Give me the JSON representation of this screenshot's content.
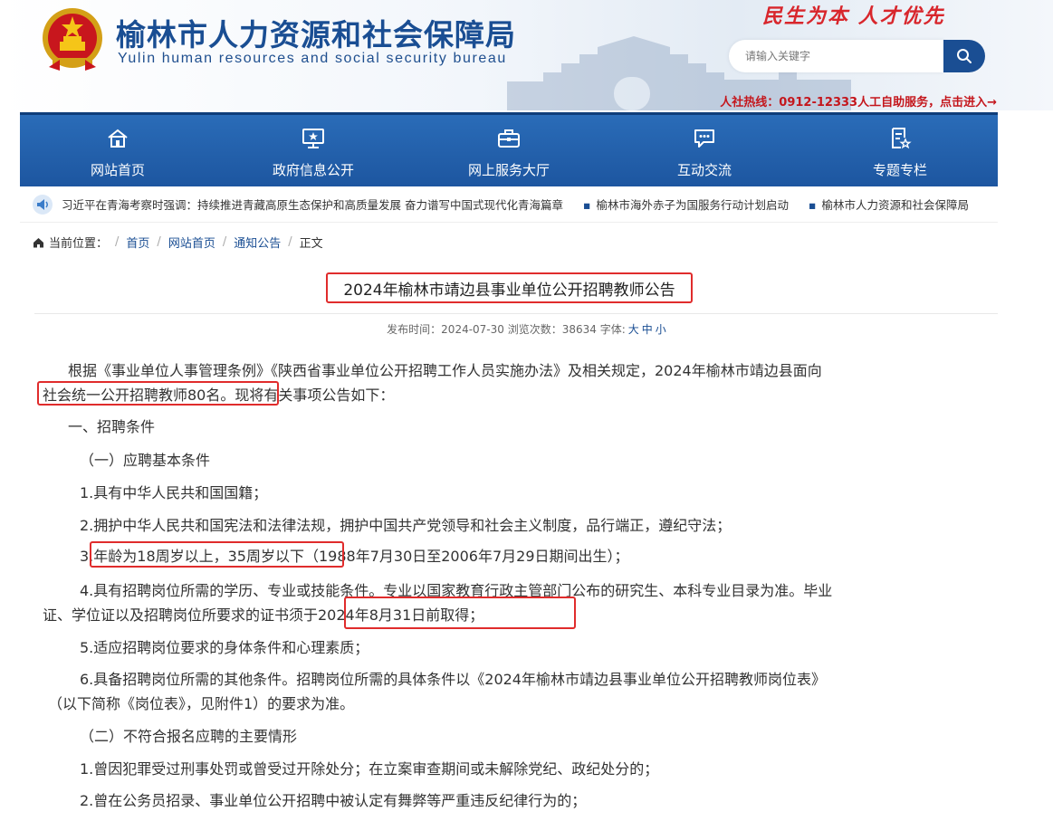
{
  "header": {
    "site_title": "榆林市人力资源和社会保障局",
    "site_subtitle": "Yulin human resources and social security bureau",
    "slogan": "民生为本  人才优先",
    "search_placeholder": "请输入关键字",
    "hotline": "人社热线：0912-12333人工自助服务，点击进入→",
    "colors": {
      "brand_blue": "#1a4e93",
      "accent_red": "#d8262c"
    }
  },
  "nav": {
    "items": [
      {
        "label": "网站首页",
        "icon": "home-icon"
      },
      {
        "label": "政府信息公开",
        "icon": "monitor-star-icon"
      },
      {
        "label": "网上服务大厅",
        "icon": "briefcase-icon"
      },
      {
        "label": "互动交流",
        "icon": "chat-icon"
      },
      {
        "label": "专题专栏",
        "icon": "document-star-icon"
      }
    ]
  },
  "ticker": {
    "icon": "speaker-icon",
    "items": [
      "习近平在青海考察时强调：持续推进青藏高原生态保护和高质量发展 奋力谱写中国式现代化青海篇章",
      "榆林市海外赤子为国服务行动计划启动",
      "榆林市人力资源和社会保障局"
    ]
  },
  "breadcrumb": {
    "prefix": "当前位置：",
    "items": [
      "首页",
      "网站首页",
      "通知公告",
      "正文"
    ]
  },
  "article": {
    "title": "2024年榆林市靖边县事业单位公开招聘教师公告",
    "meta_prefix": "发布时间：2024-07-30 浏览次数：38634 字体:",
    "font_sizes": [
      "大",
      "中",
      "小"
    ],
    "paragraphs": [
      "根据《事业单位人事管理条例》《陕西省事业单位公开招聘工作人员实施办法》及相关规定，2024年榆林市靖边县面向",
      "社会统一公开招聘教师80名。现将有关事项公告如下：",
      "一、招聘条件",
      "（一）应聘基本条件",
      "1.具有中华人民共和国国籍；",
      "2.拥护中华人民共和国宪法和法律法规，拥护中国共产党领导和社会主义制度，品行端正，遵纪守法；",
      "3.年龄为18周岁以上，35周岁以下（1988年7月30日至2006年7月29日期间出生）；",
      "4.具有招聘岗位所需的学历、专业或技能条件。专业以国家教育行政主管部门公布的研究生、本科专业目录为准。毕业",
      "证、学位证以及招聘岗位所要求的证书须于2024年8月31日前取得；",
      "5.适应招聘岗位要求的身体条件和心理素质；",
      "6.具备招聘岗位所需的其他条件。招聘岗位所需的具体条件以《2024年榆林市靖边县事业单位公开招聘教师岗位表》",
      "（以下简称《岗位表》，见附件1）的要求为准。",
      "（二）不符合报名应聘的主要情形",
      "1.曾因犯罪受过刑事处罚或曾受过开除处分；在立案审查期间或未解除党纪、政纪处分的；",
      "2.曾在公务员招录、事业单位公开招聘中被认定有舞弊等严重违反纪律行为的；"
    ]
  }
}
